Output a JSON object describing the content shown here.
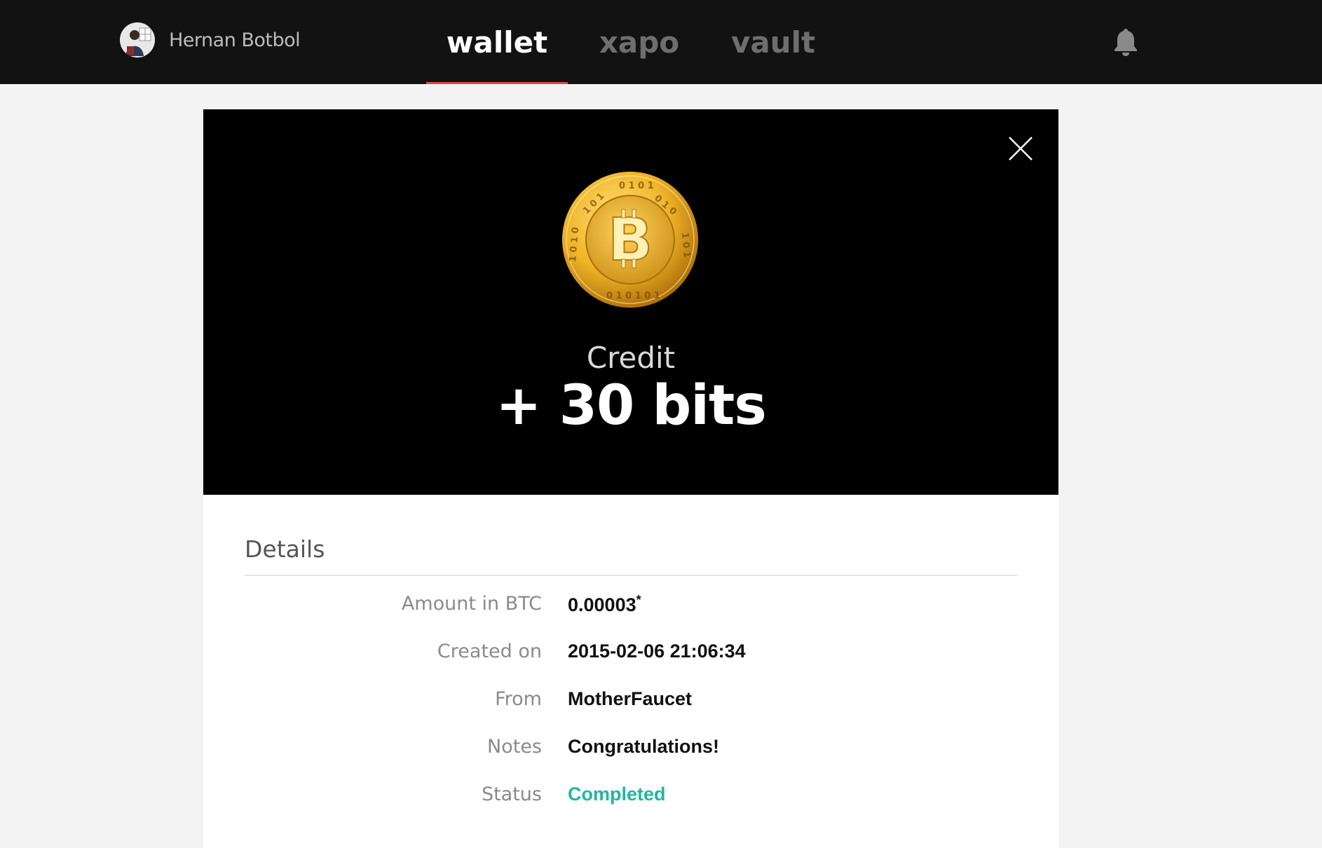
{
  "header": {
    "user_name": "Hernan Botbol",
    "tabs": [
      {
        "label": "wallet",
        "active": true
      },
      {
        "label": "xapo",
        "active": false
      },
      {
        "label": "vault",
        "active": false
      }
    ],
    "icons": {
      "avatar": "user-avatar",
      "notifications": "bell-icon"
    }
  },
  "transaction": {
    "icon": "bitcoin-coin-icon",
    "coin_symbol": "B",
    "type": "Credit",
    "amount": "+ 30 bits"
  },
  "details": {
    "title": "Details",
    "rows": [
      {
        "label": "Amount in BTC",
        "value": "0.00003",
        "footnote_mark": "*"
      },
      {
        "label": "Created on",
        "value": "2015-02-06 21:06:34"
      },
      {
        "label": "From",
        "value": "MotherFaucet"
      },
      {
        "label": "Notes",
        "value": "Congratulations!"
      },
      {
        "label": "Status",
        "value": "Completed"
      }
    ]
  },
  "colors": {
    "topbar": "#121212",
    "active_tab_underline": "#e0454f",
    "status_completed": "#22b5a4",
    "coin_gold": "#f0b429"
  }
}
